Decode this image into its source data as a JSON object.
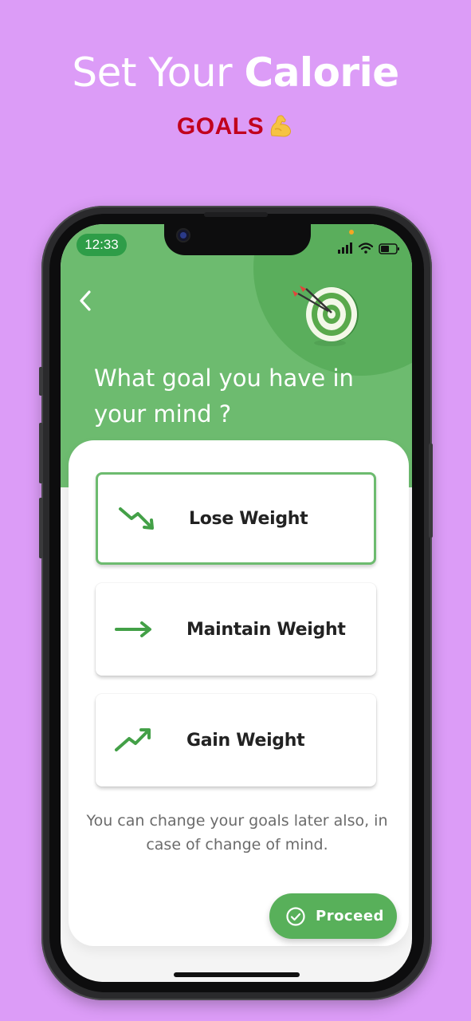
{
  "hero": {
    "title_light": "Set Your ",
    "title_bold": "Calorie",
    "subtitle": "GOALS",
    "subtitle_emoji": "flexed-biceps-icon"
  },
  "status_bar": {
    "time": "12:33",
    "icons": [
      "signal-icon",
      "wifi-icon",
      "battery-icon"
    ]
  },
  "header": {
    "back_icon": "chevron-left-icon",
    "illustration": "target-dart-icon",
    "question": "What goal you have in your mind ?"
  },
  "goals": [
    {
      "label": "Lose Weight",
      "icon": "trend-down-icon",
      "selected": true
    },
    {
      "label": "Maintain Weight",
      "icon": "arrow-right-icon",
      "selected": false
    },
    {
      "label": "Gain Weight",
      "icon": "trend-up-icon",
      "selected": false
    }
  ],
  "note": "You can change your goals later also, in case of change of mind.",
  "proceed_button": {
    "label": "Proceed",
    "icon": "check-circle-icon"
  },
  "colors": {
    "background": "#dc9cf7",
    "header_green": "#6dbb6f",
    "accent_green": "#58b05a",
    "subtitle_red": "#c1001d"
  }
}
